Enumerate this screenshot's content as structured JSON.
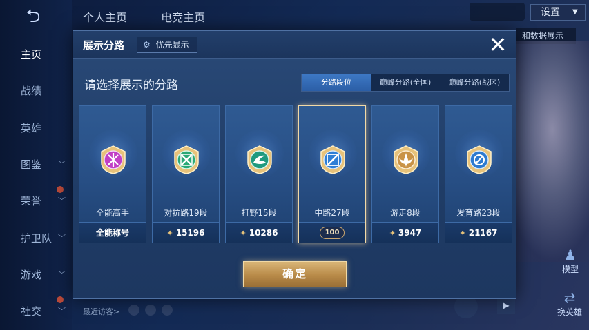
{
  "background": {
    "sidebar": [
      {
        "label": "主页",
        "active": true
      },
      {
        "label": "战绩"
      },
      {
        "label": "英雄"
      },
      {
        "label": "图鉴"
      },
      {
        "label": "荣誉"
      },
      {
        "label": "护卫队"
      },
      {
        "label": "游戏"
      },
      {
        "label": "社交"
      }
    ],
    "top_tabs": [
      "个人主页",
      "电竞主页"
    ],
    "settings_label": "设置",
    "detail_label": "和数据展示",
    "model_label": "模型",
    "swap_hero_label": "换英雄",
    "recent_visitors_label": "最近访客>"
  },
  "modal": {
    "title": "展示分路",
    "priority_label": "优先显示",
    "close_icon": "close-icon",
    "subtitle": "请选择展示的分路",
    "tabs": [
      {
        "label": "分路段位",
        "active": true
      },
      {
        "label": "巅峰分路(全国)"
      },
      {
        "label": "巅峰分路(战区)"
      }
    ],
    "cards": [
      {
        "name": "全能高手",
        "footer": "全能称号",
        "has_points": false,
        "emblem_color": "#c13fc6"
      },
      {
        "name": "对抗路19段",
        "footer": "15196",
        "has_points": true,
        "emblem_color": "#2aa876"
      },
      {
        "name": "打野15段",
        "footer": "10286",
        "has_points": true,
        "emblem_color": "#1f9a7e"
      },
      {
        "name": "中路27段",
        "footer": "100",
        "has_points": false,
        "selected": true,
        "emblem_color": "#2f7fd6"
      },
      {
        "name": "游走8段",
        "footer": "3947",
        "has_points": true,
        "emblem_color": "#c99346"
      },
      {
        "name": "发育路23段",
        "footer": "21167",
        "has_points": true,
        "emblem_color": "#2d7ad0"
      }
    ],
    "confirm_label": "确定"
  }
}
